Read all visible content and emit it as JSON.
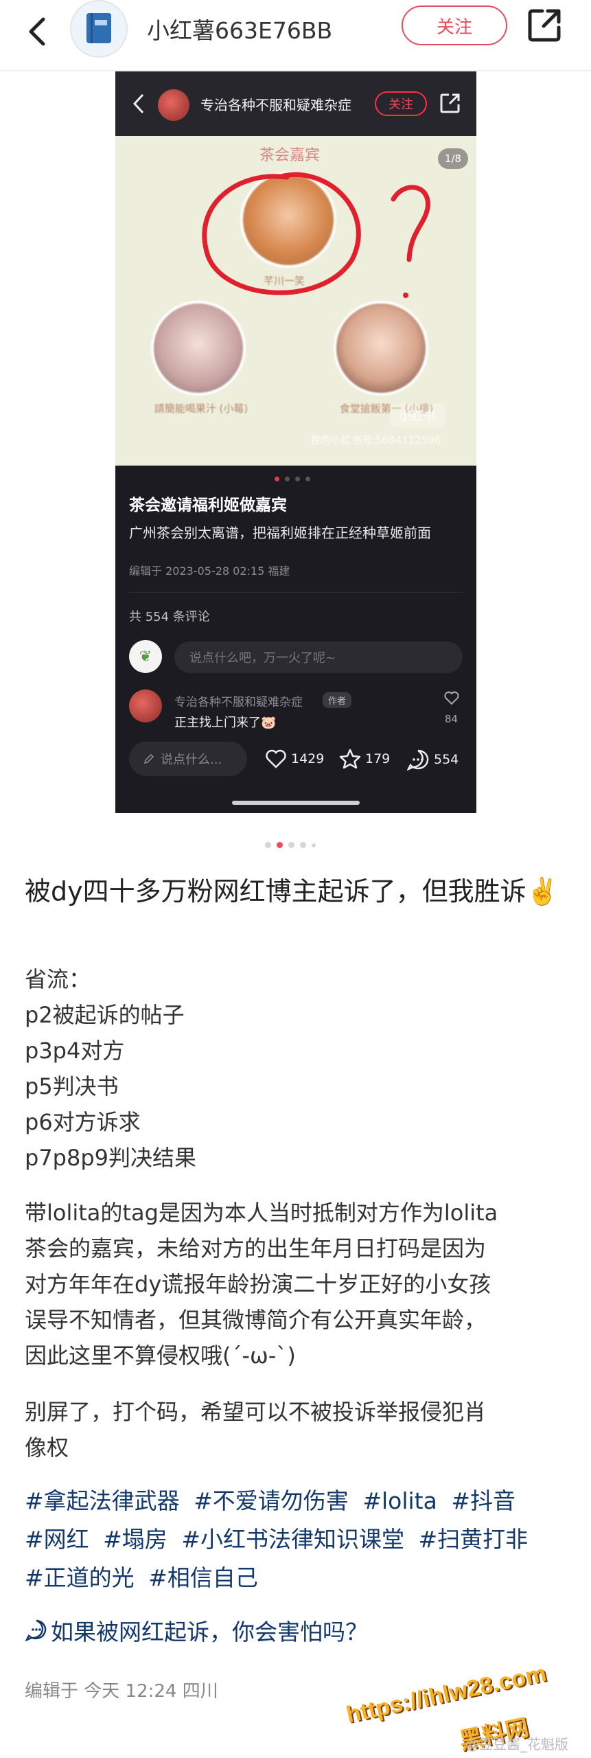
{
  "header": {
    "username": "小红薯663E76BB",
    "follow_label": "关注"
  },
  "embedded_screenshot": {
    "author_name": "专治各种不服和疑难杂症",
    "follow_label": "关注",
    "image_title": "茶会嘉宾",
    "image_counter": "1/8",
    "guest_center_label": "芊川一笑",
    "guest_left_label": "請簡能喝果汁 (小莓)",
    "guest_right_label": "食堂搶飯第一 (小樓)",
    "watermark": "小红书",
    "watermark_id": "我的小红书号:5604112596",
    "post_title": "茶会邀请福利姬做嘉宾",
    "post_body": "广州茶会别太离谱，把福利姬排在正经种草姬前面",
    "post_edited": "编辑于 2023-05-28 02:15 福建",
    "comment_count": "共 554 条评论",
    "comment_placeholder": "说点什么吧，万一火了呢~",
    "comment_author": "专治各种不服和疑难杂症",
    "comment_badge": "作者",
    "comment_text": "正主找上门来了🐷",
    "comment_likes": "84",
    "bottom_input": "说点什么...",
    "likes": "1429",
    "stars": "179",
    "comments": "554"
  },
  "note": {
    "title": "被dy四十多万粉网红博主起诉了，但我胜诉✌️",
    "summary_lines": [
      "省流：",
      "p2被起诉的帖子",
      "p3p4对方",
      "p5判决书",
      "p6对方诉求",
      "p7p8p9判决结果"
    ],
    "paragraph1_lines": [
      "带lolita的tag是因为本人当时抵制对方作为lolita",
      "茶会的嘉宾，未给对方的出生年月日打码是因为",
      "对方年年在dy谎报年龄扮演二十岁正好的小女孩",
      "误导不知情者，但其微博简介有公开真实年龄，",
      "因此这里不算侵权哦(´-ω-`)"
    ],
    "paragraph2_lines": [
      "别屏了，打个码，希望可以不被投诉举报侵犯肖",
      "像权"
    ],
    "tags": [
      "#拿起法律武器",
      "#不爱请勿伤害",
      "#lolita",
      "#抖音",
      "#网红",
      "#塌房",
      "#小红书法律知识课堂",
      "#扫黄打非",
      "#正道的光",
      "#相信自己"
    ],
    "question": "如果被网红起诉，你会害怕吗？",
    "footer_time": "编辑于  今天 12:24 四川"
  },
  "watermarks": {
    "site": "https://ihlw28.com",
    "site_name": "黑料网",
    "weibo": "@豆豆酱_花魁版"
  },
  "colors": {
    "accent": "#e94c5a",
    "tag_blue": "#13386c"
  }
}
